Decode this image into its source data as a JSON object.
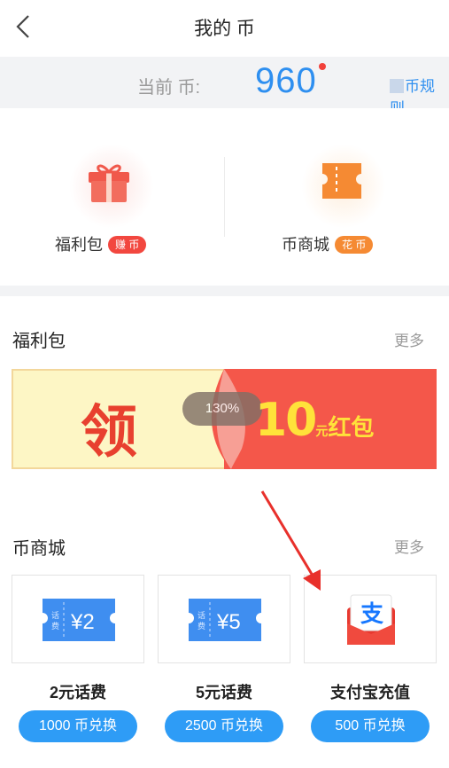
{
  "header": {
    "title": "我的 币"
  },
  "balance": {
    "label": "当前 币:",
    "value": "960",
    "rules_label": "币规则"
  },
  "entries": [
    {
      "label": "福利包",
      "badge": "赚 币",
      "icon": "gift-box-icon"
    },
    {
      "label": "币商城",
      "badge": "花 币",
      "icon": "ticket-icon"
    }
  ],
  "welfare": {
    "title": "福利包",
    "more": "更多",
    "banner": {
      "left_text": "领",
      "percent": "130%",
      "amount": "10",
      "unit": "元",
      "suffix": "红包"
    }
  },
  "mall": {
    "title": "币商城",
    "more": "更多",
    "items": [
      {
        "name": "2元话费",
        "button": "1000 币兑换",
        "ticket_value": "¥2",
        "ticket_tag": "话费"
      },
      {
        "name": "5元话费",
        "button": "2500 币兑换",
        "ticket_value": "¥5",
        "ticket_tag": "话费"
      },
      {
        "name": "支付宝充值",
        "button": "500 币兑换",
        "icon": "alipay-redpacket-icon"
      }
    ]
  },
  "colors": {
    "accent": "#2e8ff0",
    "button": "#2e9cf6",
    "red": "#f2473f",
    "orange": "#f58a33"
  }
}
